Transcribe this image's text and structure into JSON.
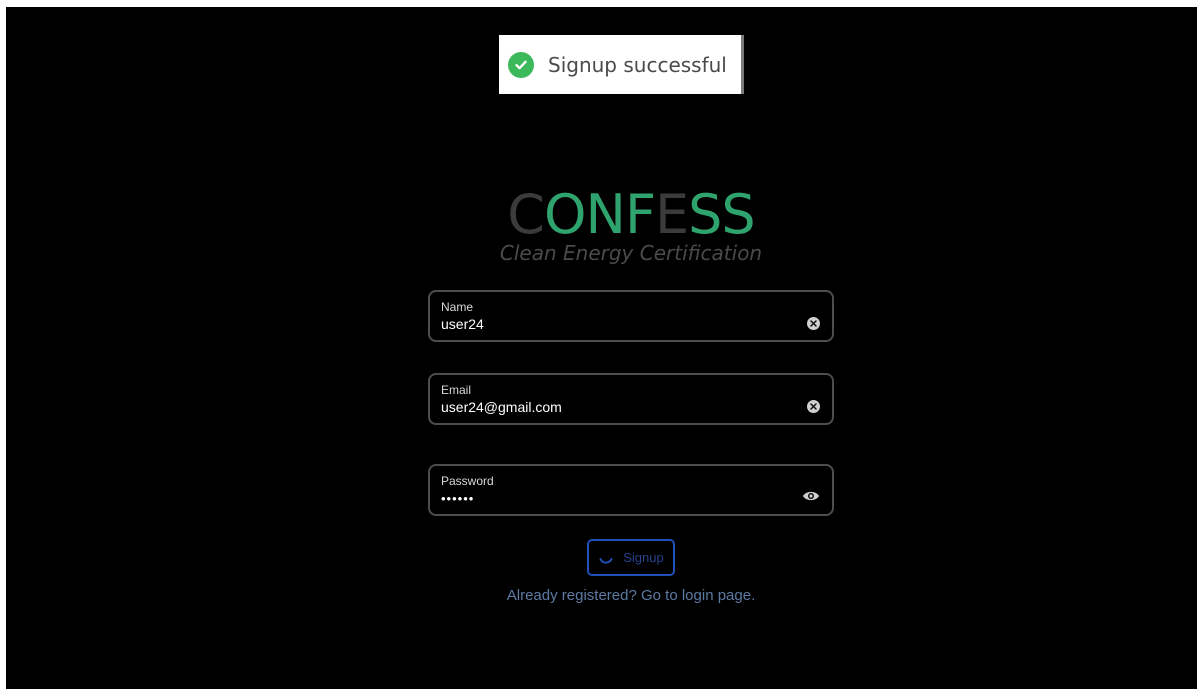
{
  "toast": {
    "message": "Signup successful",
    "icon": "check-circle-icon",
    "icon_color": "#3cb95a"
  },
  "logo": {
    "letters": [
      {
        "char": "C",
        "color": "#3b3b3b"
      },
      {
        "char": "O",
        "color": "#2fa36d"
      },
      {
        "char": "N",
        "color": "#2fa36d"
      },
      {
        "char": "F",
        "color": "#2fa36d"
      },
      {
        "char": "E",
        "color": "#3b3b3b"
      },
      {
        "char": "S",
        "color": "#2fa36d"
      },
      {
        "char": "S",
        "color": "#2fa36d"
      }
    ],
    "tagline": "Clean Energy Certification"
  },
  "form": {
    "name": {
      "label": "Name",
      "value": "user24"
    },
    "email": {
      "label": "Email",
      "value": "user24@gmail.com"
    },
    "password": {
      "label": "Password",
      "value": "••••••"
    },
    "submit_label": "Signup",
    "login_link": "Already registered? Go to login page."
  },
  "colors": {
    "accent_green": "#2fa36d",
    "button_border": "#1f4fb8",
    "link": "#5d7aa3"
  }
}
